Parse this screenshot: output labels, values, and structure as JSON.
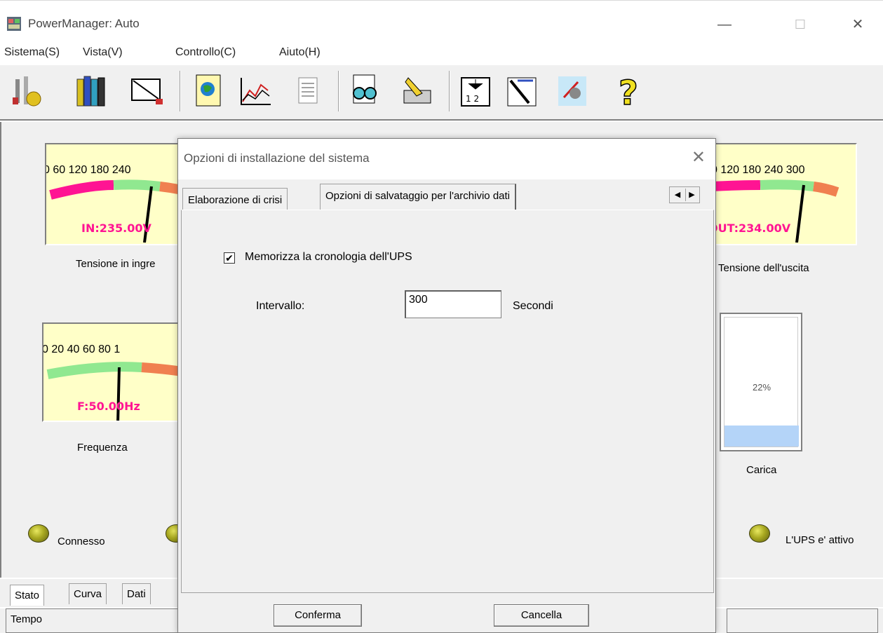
{
  "window": {
    "title": "PowerManager: Auto",
    "minimize": "—",
    "maximize": "☐",
    "close": "✕"
  },
  "menu": [
    "Sistema(S)",
    "Vista(V)",
    "Controllo(C)",
    "Aiuto(H)"
  ],
  "gauges": {
    "input": {
      "scale": "0  60 120 180 240",
      "reading": "IN:235.00V",
      "label": "Tensione in ingre"
    },
    "output": {
      "scale": "0 120 180 240 300",
      "reading": "OUT:234.00V",
      "label": "Tensione dell'uscita"
    },
    "frequency": {
      "scale": "0  20  40  60  80  1",
      "reading": "F:50.00Hz",
      "label": "Frequenza"
    },
    "load": {
      "percent": "22%",
      "fill": 0.22,
      "label": "Carica"
    }
  },
  "status_lights": {
    "connected": "Connesso",
    "ups_active": "L'UPS e' attivo"
  },
  "bottom_tabs": [
    "Stato",
    "Curva",
    "Dati"
  ],
  "status_bar": {
    "time": "Tempo"
  },
  "dialog": {
    "title": "Opzioni di installazione del sistema",
    "close": "✕",
    "tabs": [
      "Elaborazione di crisi",
      "Opzioni di salvataggio per l'archivio dati"
    ],
    "checkbox_label": "Memorizza la cronologia dell'UPS",
    "checkbox_checked": true,
    "interval_label": "Intervallo:",
    "interval_value": "300",
    "interval_unit": "Secondi",
    "confirm": "Conferma",
    "cancel": "Cancella"
  },
  "colors": {
    "gauge_bg": "#ffffc8",
    "reading": "#ff1493",
    "load_fill": "#b4d4f8"
  }
}
